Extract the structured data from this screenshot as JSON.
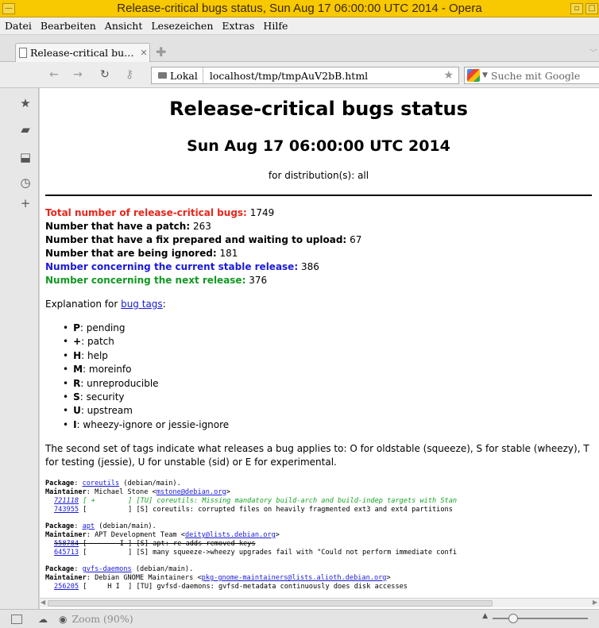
{
  "window": {
    "title": "Release-critical bugs status, Sun Aug 17 06:00:00 UTC 2014 - Opera"
  },
  "menubar": {
    "items": [
      "Datei",
      "Bearbeiten",
      "Ansicht",
      "Lesezeichen",
      "Extras",
      "Hilfe"
    ]
  },
  "tabs": [
    {
      "label": "Release-critical bu…",
      "active": true
    }
  ],
  "addressbar": {
    "security_label": "Lokal",
    "url": "localhost/tmp/tmpAuV2bB.html",
    "search_placeholder": "Suche mit Google"
  },
  "sidebar": {
    "icons": [
      "bookmarks-icon",
      "notes-icon",
      "downloads-icon",
      "history-icon",
      "add-panel-icon"
    ]
  },
  "page": {
    "title": "Release-critical bugs status",
    "date": "Sun Aug 17 06:00:00 UTC 2014",
    "distribution": "for distribution(s): all",
    "stats": [
      {
        "label": "Total number of release-critical bugs:",
        "value": "1749",
        "color": "#e8261c"
      },
      {
        "label": "Number that have a patch:",
        "value": "263",
        "color": "#000000"
      },
      {
        "label": "Number that have a fix prepared and waiting to upload:",
        "value": "67",
        "color": "#000000"
      },
      {
        "label": "Number that are being ignored:",
        "value": "181",
        "color": "#000000"
      },
      {
        "label": "Number concerning the current stable release:",
        "value": "386",
        "color": "#1a1ad8"
      },
      {
        "label": "Number concerning the next release:",
        "value": "376",
        "color": "#119922"
      }
    ],
    "explanation_prefix": "Explanation for",
    "explanation_link": "bug tags",
    "explanation_suffix": ":",
    "tags": [
      {
        "key": "P",
        "desc": ": pending"
      },
      {
        "key": "+",
        "desc": ": patch"
      },
      {
        "key": "H",
        "desc": ": help"
      },
      {
        "key": "M",
        "desc": ": moreinfo"
      },
      {
        "key": "R",
        "desc": ": unreproducible"
      },
      {
        "key": "S",
        "desc": ": security"
      },
      {
        "key": "U",
        "desc": ": upstream"
      },
      {
        "key": "I",
        "desc": ": wheezy-ignore or jessie-ignore"
      }
    ],
    "second_tags_text": "The second set of tags indicate what releases a bug applies to: O for oldstable (squeeze), S for stable (wheezy), T for testing (jessie), U for unstable (sid) or E for experimental.",
    "packages": [
      {
        "package_label": "Package",
        "package": "coreutils",
        "package_suffix": " (debian/main).",
        "maintainer_label": "Maintainer",
        "maintainer": "Michael Stone <",
        "email": "mstone@debian.org",
        "email_suffix": ">",
        "bugs": [
          {
            "id": "721118",
            "tags": " [ +        ] ",
            "text": "[TU] coreutils: Missing mandatory build-arch and build-indep targets with Stan",
            "style": "green-italic"
          },
          {
            "id": "743955",
            "tags": " [          ] ",
            "text": "[S] coreutils: corrupted files on heavily fragmented ext3 and ext4 partitions",
            "style": "normal"
          }
        ]
      },
      {
        "package_label": "Package",
        "package": "apt",
        "package_suffix": " (debian/main).",
        "maintainer_label": "Maintainer",
        "maintainer": "APT Development Team <",
        "email": "deity@lists.debian.org",
        "email_suffix": ">",
        "bugs": [
          {
            "id": "558784",
            "tags": " [        I ] ",
            "text": "[S] apt: re-adds removed keys",
            "style": "strike"
          },
          {
            "id": "645713",
            "tags": " [          ] ",
            "text": "[S] many squeeze->wheezy upgrades fail with \"Could not perform immediate confi",
            "style": "normal"
          }
        ]
      },
      {
        "package_label": "Package",
        "package": "gvfs-daemons",
        "package_suffix": " (debian/main).",
        "maintainer_label": "Maintainer",
        "maintainer": "Debian GNOME Maintainers <",
        "email": "pkg-gnome-maintainers@lists.alioth.debian.org",
        "email_suffix": ">",
        "bugs": [
          {
            "id": "256205",
            "tags": " [     H I  ] ",
            "text": "[TU] gvfsd-daemons: gvfsd-metadata continuously does disk accesses",
            "style": "normal"
          }
        ]
      }
    ]
  },
  "statusbar": {
    "zoom_label": "Zoom (90%)",
    "zoom_value": 0.9
  }
}
